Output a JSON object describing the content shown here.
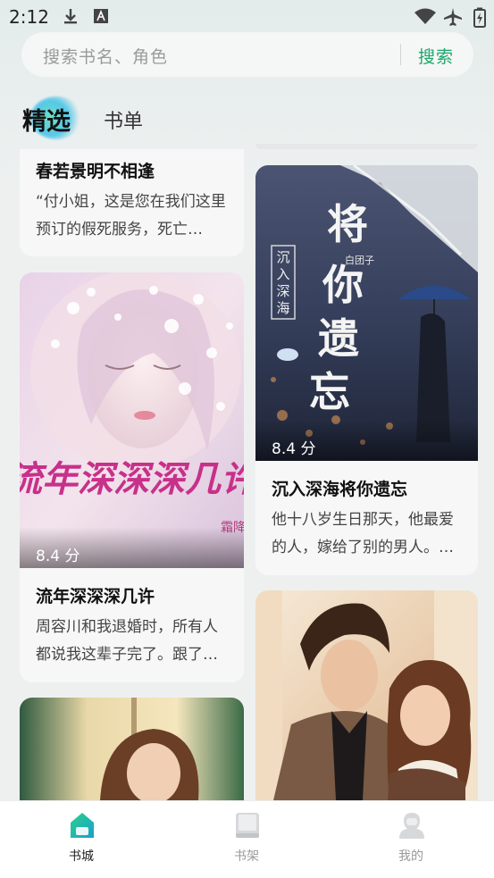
{
  "status_bar": {
    "time": "2:12",
    "icons": [
      "download-icon",
      "font-a-icon",
      "wifi-icon",
      "airplane-icon",
      "battery-charging-icon"
    ]
  },
  "search": {
    "placeholder": "搜索书名、角色",
    "button_label": "搜索"
  },
  "tabs": [
    {
      "label": "精选",
      "selected": true
    },
    {
      "label": "书单",
      "selected": false
    }
  ],
  "books_left": [
    {
      "title": "春若景明不相逢",
      "desc": "“付小姐，这是您在我们这里预订的假死服务，死亡…"
    },
    {
      "title": "流年深深深几许",
      "desc": "周容川和我退婚时，所有人都说我这辈子完了。跟了…",
      "score": "8.4 分",
      "cover_title": "流年深深深几许",
      "cover_author": "霜降"
    },
    {
      "cover": "girl-by-window"
    }
  ],
  "books_right": [
    {
      "title": "沉入深海将你遗忘",
      "desc": "他十八岁生日那天，他最爱的人，嫁给了别的男人。…",
      "score": "8.4 分",
      "cover_big": "将你遗忘",
      "cover_side": "沉入深海",
      "cover_author": "白团子"
    },
    {
      "cover": "couple-illustration"
    }
  ],
  "bottom_nav": [
    {
      "label": "书城",
      "icon": "bookstore-icon",
      "active": true
    },
    {
      "label": "书架",
      "icon": "bookshelf-icon",
      "active": false
    },
    {
      "label": "我的",
      "icon": "profile-icon",
      "active": false
    }
  ],
  "colors": {
    "accent": "#1aa86a",
    "background": "#eef0f0"
  }
}
